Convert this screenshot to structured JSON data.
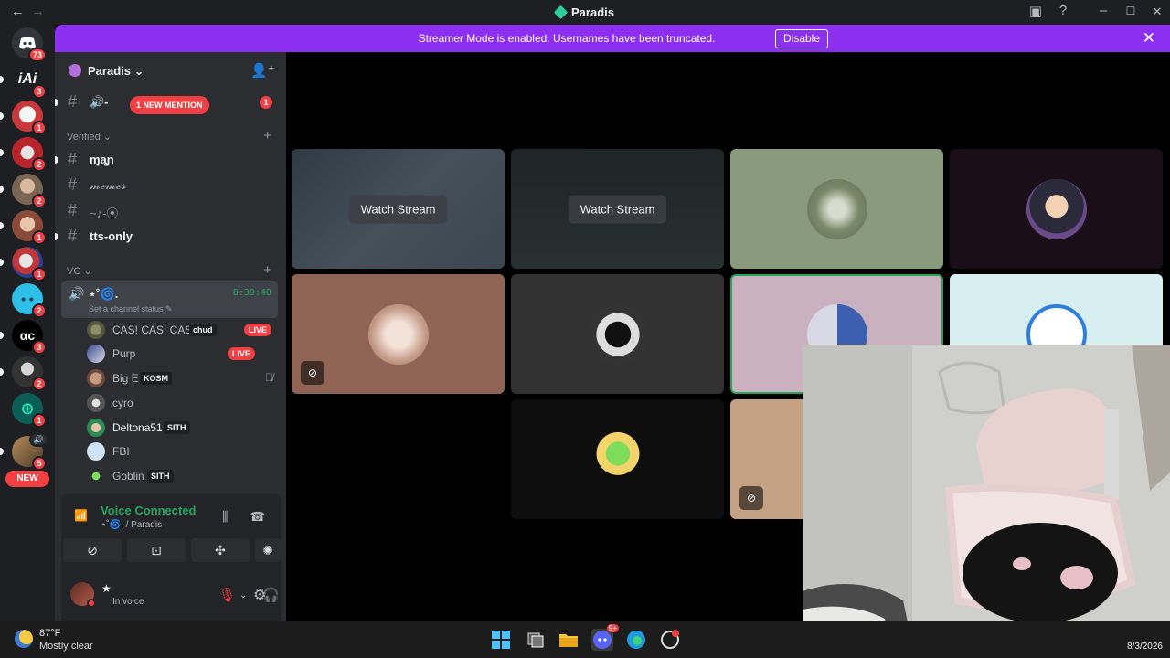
{
  "window": {
    "title": "Paradis",
    "back_glyph": "←",
    "forward_glyph": "→",
    "icons": [
      "inbox-icon",
      "help-icon",
      "minimize-icon",
      "maximize-icon",
      "close-icon"
    ]
  },
  "rail": {
    "badges": [
      "73",
      "3",
      "1",
      "2",
      "2",
      "1",
      "1",
      "2",
      "3",
      "2",
      "1",
      "5"
    ],
    "new_label": "NEW",
    "monograms": [
      "iAi",
      "αc"
    ]
  },
  "banner": {
    "message": "Streamer Mode is enabled. Usernames have been truncated.",
    "disable_label": "Disable",
    "close_glyph": "✕"
  },
  "guild": {
    "name": "Paradis",
    "chevron": "⌄"
  },
  "channels": {
    "top_channel": "🔊-",
    "mention_pill": "1 NEW MENTION",
    "mention_count": "1",
    "categories": {
      "verified": "Verified ⌄",
      "vc": "VC ⌄"
    },
    "text_channels": [
      {
        "label": "ɱąɲ"
      },
      {
        "label": "𝓶𝓮𝓶𝓮𝓼"
      },
      {
        "label": "~♪-⦿"
      },
      {
        "label": "tts-only"
      }
    ]
  },
  "voice_channel": {
    "name": "⋆˚🌀.",
    "elapsed": "8:39:48",
    "status": "Set a channel status ✎",
    "users": [
      {
        "name": "CAS! CAS! CAS!",
        "tag": "chud",
        "live": "LIVE"
      },
      {
        "name": "Purp",
        "live": "LIVE"
      },
      {
        "name": "Big E",
        "tag": "KOSM"
      },
      {
        "name": "cyro"
      },
      {
        "name": "Deltona51",
        "tag": "SITH"
      },
      {
        "name": "FBI"
      },
      {
        "name": "Goblin",
        "tag": "SITH"
      }
    ]
  },
  "voice_panel": {
    "title": "Voice Connected",
    "subtitle": "⋆˚🌀. / Paradis"
  },
  "user_panel": {
    "name": "★",
    "status": "In voice"
  },
  "stage": {
    "watch_label": "Watch Stream",
    "watch_label_2": "Watch Stream"
  },
  "taskbar": {
    "temp": "87°F",
    "condition": "Mostly clear",
    "date": "8/3/2026",
    "discord_badge": "9+"
  },
  "colors": {
    "accent": "#8c2ff0",
    "live": "#f23f43",
    "connected": "#23a55a",
    "sidebar": "#2b2d31",
    "rail": "#1e1f22"
  }
}
